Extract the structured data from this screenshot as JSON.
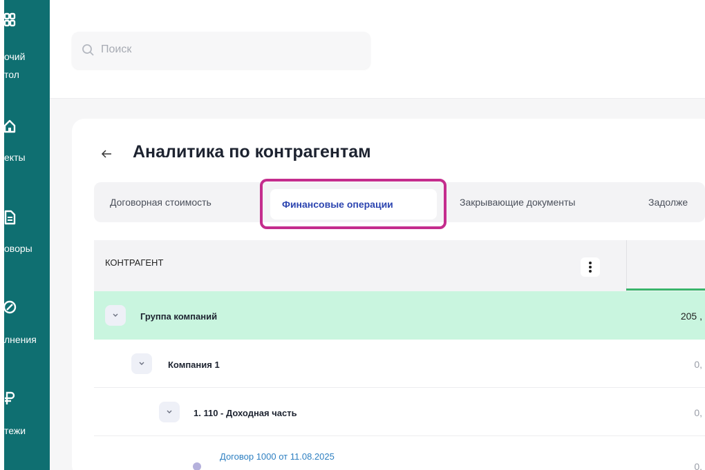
{
  "sidebar": {
    "items": [
      {
        "label_line1": "очий",
        "label_line2": "тол",
        "icon": "grid-icon"
      },
      {
        "label_line1": "екты",
        "label_line2": "",
        "icon": "home-icon"
      },
      {
        "label_line1": "оворы",
        "label_line2": "",
        "icon": "document-icon"
      },
      {
        "label_line1": "лнения",
        "label_line2": "",
        "icon": "check-circle-icon"
      },
      {
        "label_line1": "тежи",
        "label_line2": "",
        "icon": "currency-icon"
      }
    ]
  },
  "search": {
    "placeholder": "Поиск"
  },
  "page": {
    "title": "Аналитика по контрагентам"
  },
  "tabs": [
    {
      "label": "Договорная стоимость",
      "active": false
    },
    {
      "label": "Финансовые операции",
      "active": true
    },
    {
      "label": "Закрывающие документы",
      "active": false
    },
    {
      "label": "Задолже",
      "active": false
    }
  ],
  "table": {
    "column_header": "КОНТРАГЕНТ",
    "rows": [
      {
        "label": "Группа компаний",
        "value": "205 ,"
      },
      {
        "label": "Компания 1",
        "value": "0,"
      },
      {
        "label": "1. 110 - Доходная часть",
        "value": "0,"
      },
      {
        "label": "Договор 1000 от 11.08.2025",
        "value": "0,"
      }
    ]
  },
  "colors": {
    "sidebar": "#0f6f71",
    "group_row": "#c9f5df",
    "active_tab_text": "#2c45b0",
    "highlight_border": "#c42d8d",
    "header_accent": "#39b46b"
  }
}
